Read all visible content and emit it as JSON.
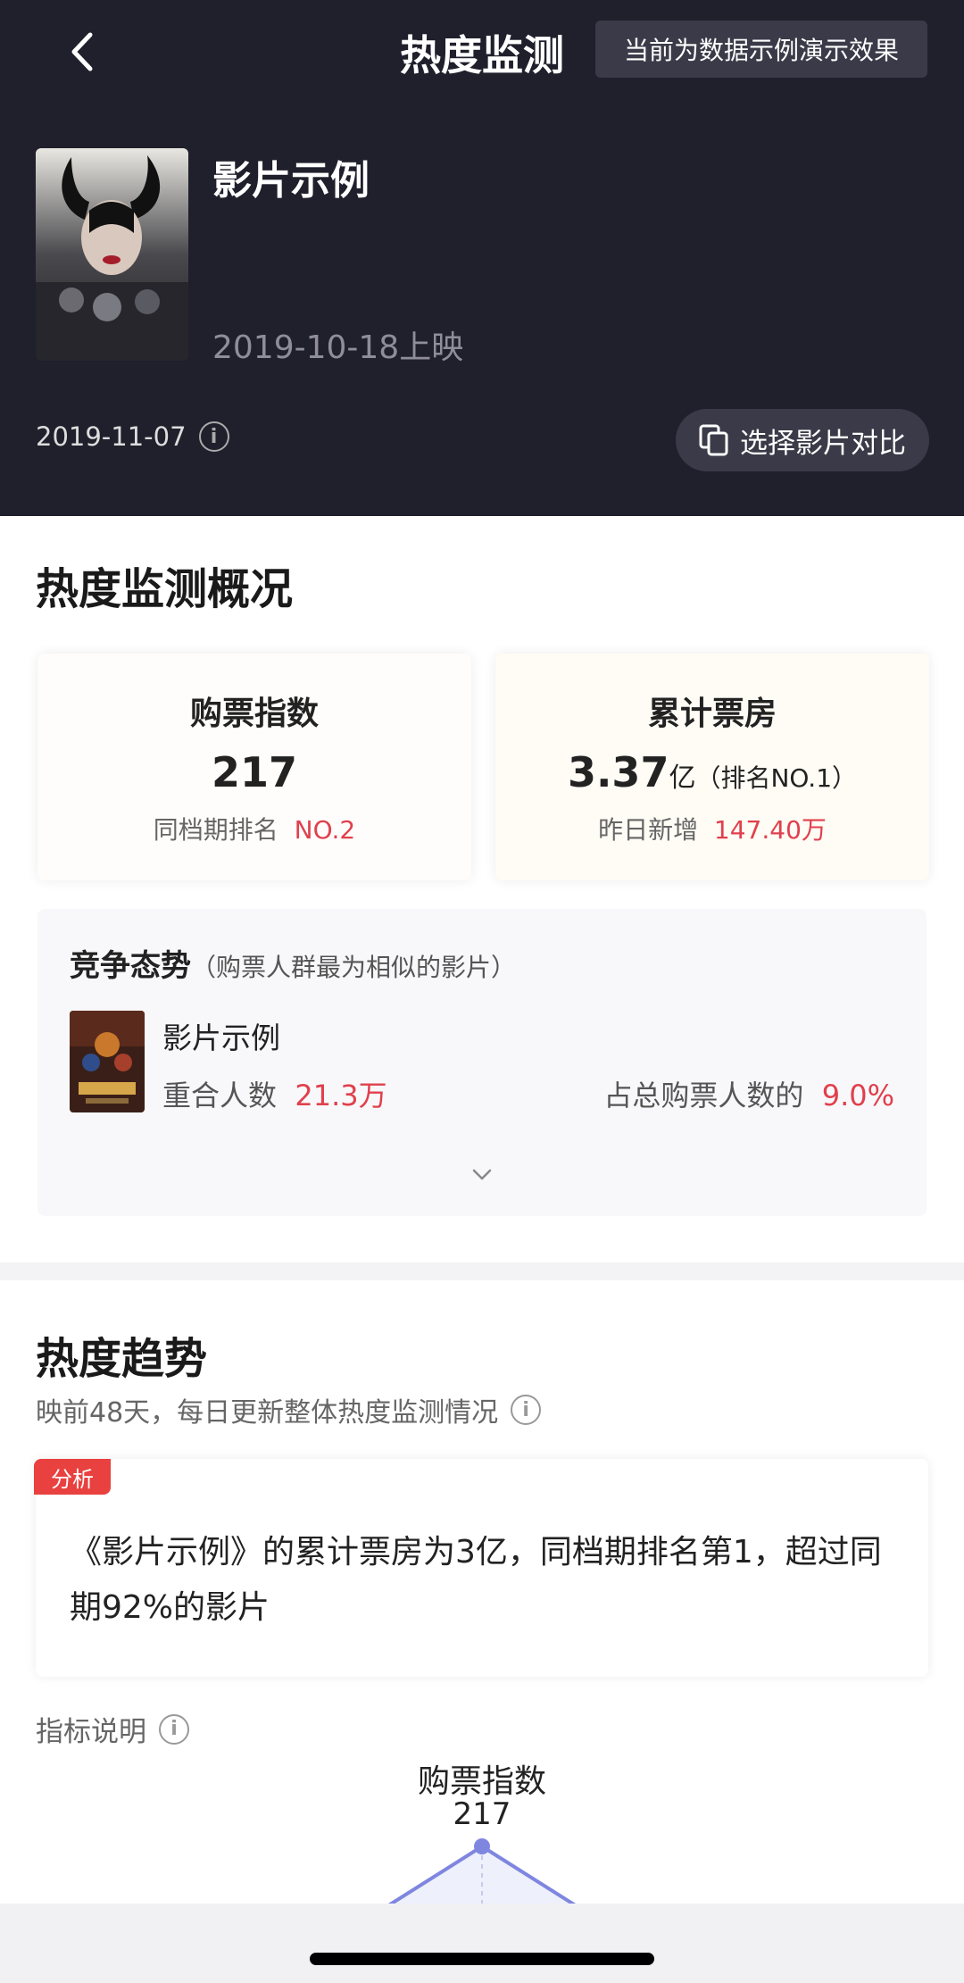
{
  "nav": {
    "title": "热度监测",
    "demo_notice": "当前为数据示例演示效果"
  },
  "movie": {
    "title": "影片示例",
    "release": "2019-10-18上映",
    "data_date": "2019-11-07",
    "compare_button": "选择影片对比"
  },
  "overview": {
    "section_title": "热度监测概况",
    "ticket_index": {
      "label": "购票指数",
      "value": "217",
      "rank_label": "同档期排名",
      "rank_value": "NO.2"
    },
    "box_office": {
      "label": "累计票房",
      "value": "3.37",
      "unit": "亿",
      "rank": "（排名NO.1）",
      "daily_label": "昨日新增",
      "daily_value": "147.40万"
    }
  },
  "competition": {
    "title": "竞争态势",
    "note": "（购票人群最为相似的影片）",
    "movie_name": "影片示例",
    "overlap_label": "重合人数",
    "overlap_value": "21.3万",
    "share_label": "占总购票人数的",
    "share_value": "9.0%"
  },
  "trend": {
    "section_title": "热度趋势",
    "subtitle": "映前48天，每日更新整体热度监测情况",
    "analysis_badge": "分析",
    "analysis_text": "《影片示例》的累计票房为3亿，同档期排名第1，超过同期92%的影片",
    "metric_label": "指标说明"
  },
  "chart_data": {
    "type": "line",
    "series": [
      {
        "name": "购票指数",
        "values": [
          217
        ]
      }
    ]
  },
  "colors": {
    "header_bg": "#201f2c",
    "accent_red": "#e0404d",
    "chart_line": "#7e86e0"
  }
}
